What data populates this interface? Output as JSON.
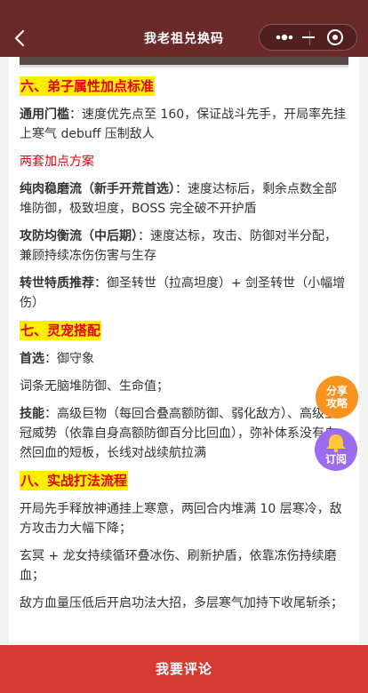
{
  "header": {
    "title": "我老祖兑换码"
  },
  "sections": {
    "s6": {
      "heading": "六、弟子属性加点标准",
      "general_label": "通用门槛",
      "general_text": "：速度优先点至 160，保证战斗先手，开局率先挂上寒气 debuff 压制敌人",
      "plans_title": "两套加点方案",
      "plan1_label": "纯肉稳磨流（新手开荒首选）",
      "plan1_text": "：速度达标后，剩余点数全部堆防御，极致坦度，BOSS 完全破不开护盾",
      "plan2_label": "攻防均衡流（中后期）",
      "plan2_text": "：速度达标，攻击、防御对半分配，兼顾持续冻伤伤害与生存",
      "reincarnation_label": "转世特质推荐",
      "reincarnation_text": "：御圣转世（拉高坦度）+ 剑圣转世（小幅增伤）"
    },
    "s7": {
      "heading": "七、灵宠搭配",
      "first_label": "首选",
      "first_text": "：御守象",
      "affix_text": "词条无脑堆防御、生命值；",
      "skill_label": "技能",
      "skill_text": "：高级巨物（每回合叠高额防御、弱化敌方）、高级宝冠威势（依靠自身高额防御百分比回血），弥补体系没有自然回血的短板，长线对战续航拉满"
    },
    "s8": {
      "heading": "八、实战打法流程",
      "p1": "开局先手释放神通挂上寒意，两回合内堆满 10 层寒冷，敌方攻击力大幅下降；",
      "p2": "玄冥 + 龙女持续循环叠冰伤、刷新护盾，依靠冻伤持续磨血；",
      "p3": "敌方血量压低后开启功法大招，多层寒气加持下收尾斩杀；"
    }
  },
  "floating": {
    "share_line1": "分享",
    "share_line2": "攻略",
    "subscribe": "订阅"
  },
  "bottom_bar": {
    "comment_label": "我要评论"
  },
  "colors": {
    "header_bg": "#6b2a2a",
    "highlight_bg": "#ffee00",
    "accent_red": "#e60012",
    "comment_bar": "#d63a34",
    "share_fab": "#f7931e",
    "subscribe_fab": "#9b6bf0"
  }
}
